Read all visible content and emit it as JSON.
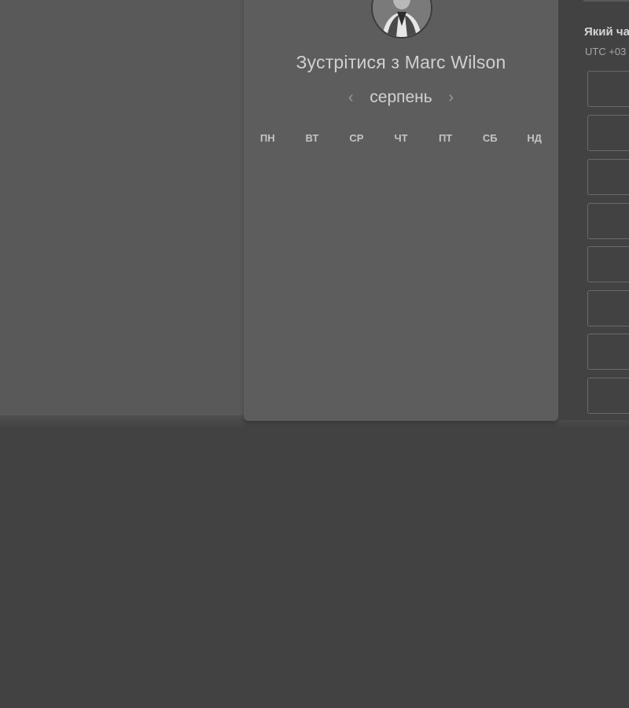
{
  "calendar": {
    "meet_title": "Зустрітися з Marc Wilson",
    "month": "серпень",
    "prev_icon": "‹",
    "next_icon": "›",
    "weekdays": [
      "ПН",
      "ВТ",
      "СР",
      "ЧТ",
      "ПТ",
      "СБ",
      "НД"
    ]
  },
  "times": {
    "title": "Який ча",
    "timezone": "UTC +03",
    "slot_count_visible": 8
  },
  "icons": {
    "avatar": "user-photo",
    "prev": "chevron-left-icon",
    "next": "chevron-right-icon"
  },
  "colors": {
    "page_background": "#424242",
    "card_background": "#5d5d5d",
    "text_primary": "#d0d0d0"
  }
}
